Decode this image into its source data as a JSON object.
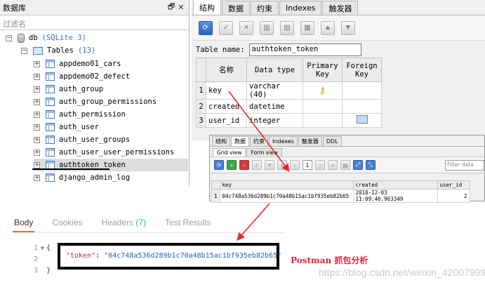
{
  "db_panel": {
    "title": "数据库",
    "controls": [
      "🗗",
      "✕"
    ],
    "filter_placeholder": "过滤名",
    "db_name": "db",
    "db_type": "(SQLite 3)",
    "tables_label": "Tables",
    "tables_count": "(13)",
    "tables": [
      "appdemo01_cars",
      "appdemo02_defect",
      "auth_group",
      "auth_group_permissions",
      "auth_permission",
      "auth_user",
      "auth_user_groups",
      "auth_user_user_permissions",
      "authtoken_token",
      "django_admin_log"
    ]
  },
  "struct_panel": {
    "tabs": [
      "结构",
      "数据",
      "约束",
      "Indexes",
      "触发器"
    ],
    "table_name_label": "Table name:",
    "table_name_value": "authtoken_token",
    "columns": [
      "名称",
      "Data type",
      "Primary Key",
      "Foreign Key"
    ],
    "rows": [
      {
        "n": "1",
        "name": "key",
        "type": "varchar (40)"
      },
      {
        "n": "2",
        "name": "created",
        "type": "datetime"
      },
      {
        "n": "3",
        "name": "user_id",
        "type": "integer"
      }
    ]
  },
  "data_window": {
    "tabs": [
      "结构",
      "数据",
      "约束",
      "Indexes",
      "触发器",
      "DDL"
    ],
    "subtabs": [
      "Grid view",
      "Form view"
    ],
    "page": "1",
    "filter_placeholder": "Filter data",
    "columns": [
      "key",
      "created",
      "user_id"
    ],
    "row": {
      "n": "1",
      "key": "04c748a536d289b1c70a48b15ac1bf935eb82b65",
      "created": "2018-12-03 11:09:46.963349",
      "user_id": "2"
    }
  },
  "postman": {
    "tabs": [
      "Body",
      "Cookies",
      "Headers",
      "(7)",
      "Test Results"
    ],
    "line_numbers": [
      "1",
      "2",
      "3"
    ],
    "open_brace": "{",
    "close_brace": "}",
    "token_key": "\"token\"",
    "colon": ": ",
    "token_value": "\"04c748a536d289b1c70a48b15ac1bf935eb82b65\""
  },
  "caption": "Postman 抓包分析",
  "watermark": "https://blog.csdn.net/weixin_42007999",
  "colors": {
    "arrow": "#e8282a",
    "accent": "#f26b3a",
    "link_blue": "#3a6fc4"
  }
}
